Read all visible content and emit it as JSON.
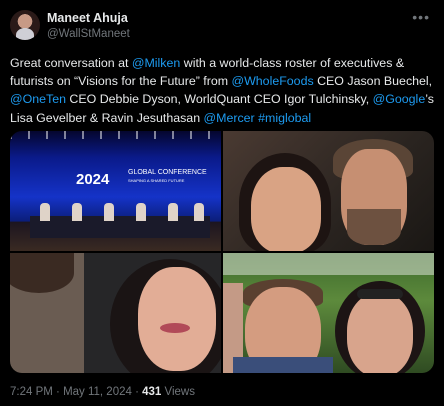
{
  "author": {
    "name": "Maneet Ahuja",
    "handle": "@WallStManeet"
  },
  "menu_icon": "more-horizontal-icon",
  "tweet": {
    "t1": "Great conversation at ",
    "m1": "@Milken",
    "t2": "  with a world-class roster of executives & futurists on “Visions for the Future” from ",
    "m2": "@WholeFoods",
    "t3": " CEO Jason Buechel, ",
    "m3": "@OneTen",
    "t4": " CEO Debbie Dyson, WorldQuant CEO Igor Tulchinsky, ",
    "m4": "@Google",
    "t5": "’s Lisa Gevelber & Ravin Jesuthasan ",
    "m5": "@Mercer",
    "t6": "  ",
    "m6": "#miglobal"
  },
  "photos": {
    "conference_year": "2024",
    "conference_name": "GLOBAL CONFERENCE",
    "conference_tagline": "SHAPING A SHARED FUTURE"
  },
  "meta": {
    "time": "7:24 PM",
    "sep1": " · ",
    "date": "May 11, 2024",
    "sep2": " · ",
    "views_count": "431",
    "views_label": " Views"
  },
  "colors": {
    "background": "#000000",
    "text": "#e7e9ea",
    "secondary": "#71767b",
    "link": "#1d9bf0"
  }
}
